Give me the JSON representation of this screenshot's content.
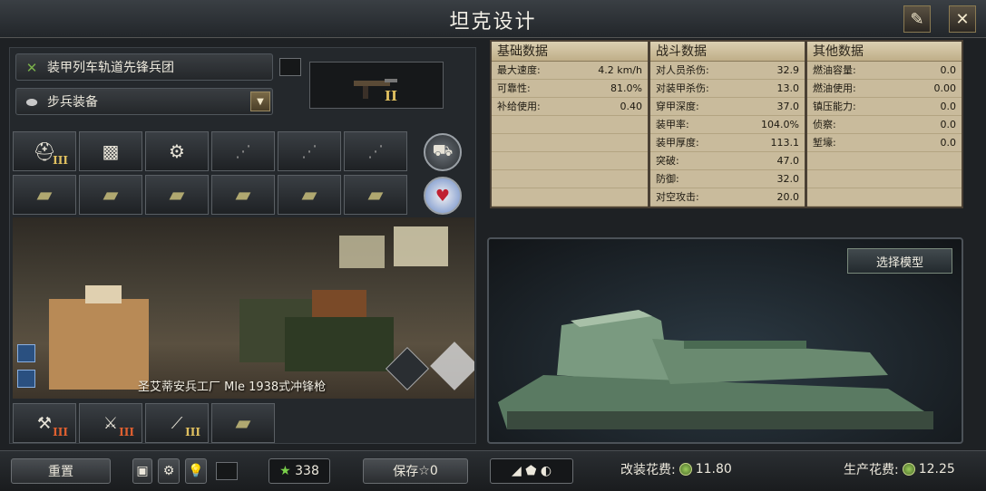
{
  "window": {
    "title": "坦克设计"
  },
  "left": {
    "division_name": "装甲列车轨道先锋兵团",
    "equipment_type": "步兵装备",
    "weapon_tier": "II",
    "top_slots": [
      {
        "name": "infantry-soldier-icon",
        "tier": "III"
      },
      {
        "name": "supply-crate-icon",
        "tier": ""
      },
      {
        "name": "anti-air-icon",
        "tier": ""
      },
      {
        "name": "rail-icon",
        "tier": ""
      },
      {
        "name": "rail-icon",
        "tier": ""
      },
      {
        "name": "rail-icon",
        "tier": ""
      }
    ],
    "mid_slots": [
      {
        "name": "armored-car-icon"
      },
      {
        "name": "armored-car-icon"
      },
      {
        "name": "armored-car-icon"
      },
      {
        "name": "tank-turret-icon"
      },
      {
        "name": "armored-car-icon"
      },
      {
        "name": "armored-car-icon"
      }
    ],
    "factory_caption": "圣艾蒂安兵工厂  Mle 1938式冲锋枪",
    "bottom_slots": [
      {
        "name": "mortar-icon",
        "tier": "III"
      },
      {
        "name": "artillery-icon",
        "tier": "III"
      },
      {
        "name": "rifle-icon",
        "tier": "III"
      },
      {
        "name": "armored-car-icon",
        "tier": ""
      }
    ]
  },
  "stats": {
    "basic": {
      "header": "基础数据",
      "rows": [
        {
          "label": "最大速度:",
          "value": "4.2 km/h"
        },
        {
          "label": "可靠性:",
          "value": "81.0%"
        },
        {
          "label": "补给使用:",
          "value": "0.40"
        }
      ]
    },
    "combat": {
      "header": "战斗数据",
      "rows": [
        {
          "label": "对人员杀伤:",
          "value": "32.9"
        },
        {
          "label": "对装甲杀伤:",
          "value": "13.0"
        },
        {
          "label": "穿甲深度:",
          "value": "37.0"
        },
        {
          "label": "装甲率:",
          "value": "104.0%"
        },
        {
          "label": "装甲厚度:",
          "value": "113.1"
        },
        {
          "label": "突破:",
          "value": "47.0"
        },
        {
          "label": "防御:",
          "value": "32.0"
        },
        {
          "label": "对空攻击:",
          "value": "20.0"
        }
      ]
    },
    "other": {
      "header": "其他数据",
      "rows": [
        {
          "label": "燃油容量:",
          "value": "0.0"
        },
        {
          "label": "燃油使用:",
          "value": "0.00"
        },
        {
          "label": "镇压能力:",
          "value": "0.0"
        },
        {
          "label": "侦察:",
          "value": "0.0"
        },
        {
          "label": "堑壕:",
          "value": "0.0"
        }
      ]
    }
  },
  "viewer": {
    "select_model": "选择模型"
  },
  "bottom": {
    "reset": "重置",
    "xp": "338",
    "save": "保存",
    "save_cost": "0",
    "refit_label": "改装花费:",
    "refit_value": "11.80",
    "prod_label": "生产花费:",
    "prod_value": "12.25"
  },
  "colors": {
    "tier_gold": "#e0c060",
    "tier_red": "#e06030",
    "xp_green": "#7ad04a"
  }
}
